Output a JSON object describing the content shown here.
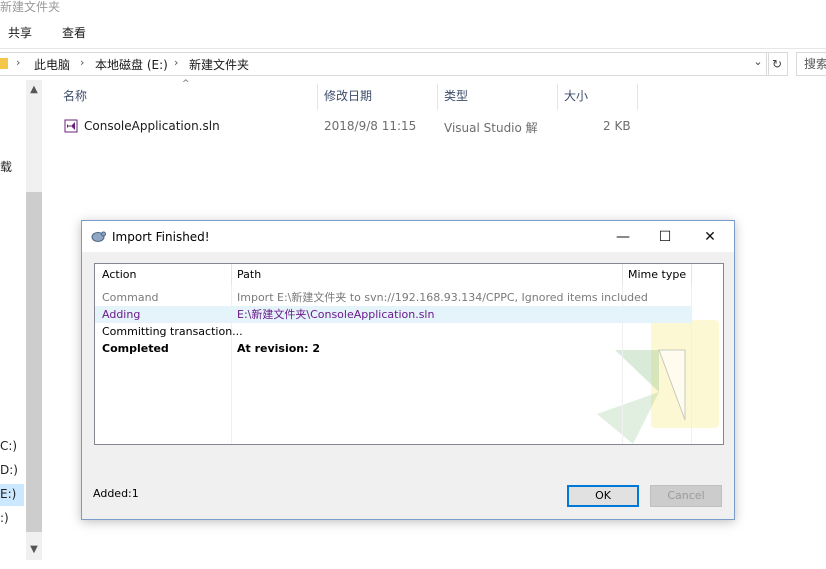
{
  "window": {
    "title": "新建文件夹"
  },
  "ribbon": {
    "tabs": [
      "共享",
      "查看"
    ]
  },
  "address": {
    "crumbs": [
      "此电脑",
      "本地磁盘 (E:)",
      "新建文件夹"
    ],
    "separator": "›",
    "dropdown_glyph": "⌄",
    "refresh_glyph": "↻"
  },
  "search": {
    "placeholder": "搜索"
  },
  "nav": {
    "fragments": [
      "载",
      "C:)",
      "D:)",
      "E:)",
      ":)"
    ]
  },
  "columns": {
    "name": "名称",
    "modified": "修改日期",
    "type": "类型",
    "size": "大小"
  },
  "files": [
    {
      "name": "ConsoleApplication.sln",
      "modified": "2018/9/8 11:15",
      "type": "Visual Studio 解",
      "size": "2 KB"
    }
  ],
  "dialog": {
    "title": "Import Finished!",
    "columns": {
      "action": "Action",
      "path": "Path",
      "mime": "Mime type"
    },
    "rows": [
      {
        "action": "Command",
        "path": "Import E:\\新建文件夹 to svn://192.168.93.134/CPPC, Ignored items included",
        "style": "gray"
      },
      {
        "action": "Adding",
        "path": "E:\\新建文件夹\\ConsoleApplication.sln",
        "style": "purple"
      },
      {
        "action": "Committing transaction...",
        "path": "",
        "style": "normal"
      },
      {
        "action": "Completed",
        "path": "At revision: 2",
        "style": "bold"
      }
    ],
    "status": "Added:1",
    "ok_label": "OK",
    "cancel_label": "Cancel",
    "colors": {
      "gray": "#7a7a7a",
      "purple": "#6a1b8a",
      "selected_row": "#e5f3fb",
      "accent": "#0078d7"
    }
  }
}
